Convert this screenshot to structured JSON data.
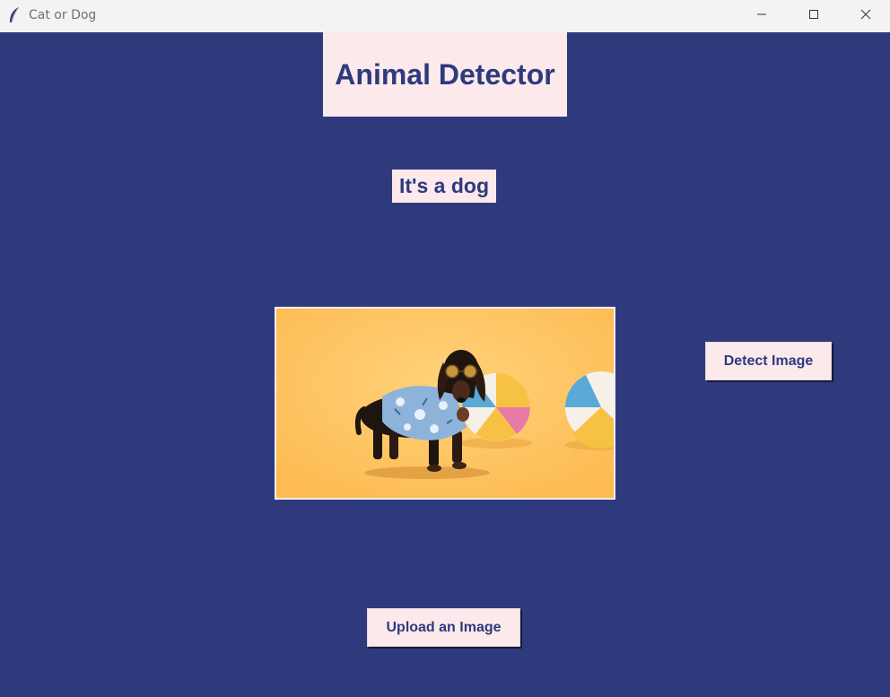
{
  "window": {
    "title": "Cat or Dog",
    "icon": "feather-icon",
    "controls": [
      "minimize-icon",
      "maximize-icon",
      "close-icon"
    ]
  },
  "main": {
    "heading": "Animal Detector",
    "result": "It's a dog",
    "image": {
      "description_icon": "dog-photo"
    },
    "detect_button": "Detect Image",
    "upload_button": "Upload an Image"
  },
  "colors": {
    "background": "#2f3a7d",
    "panel": "#fbe9ec",
    "text": "#2f3a7d",
    "photo_background": "#fec35f"
  }
}
